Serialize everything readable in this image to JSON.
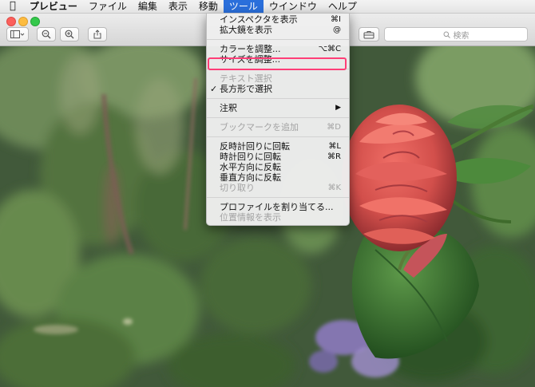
{
  "menubar": {
    "apple_icon": "apple-logo",
    "items": [
      "プレビュー",
      "ファイル",
      "編集",
      "表示",
      "移動",
      "ツール",
      "ウインドウ",
      "ヘルプ"
    ]
  },
  "toolbar": {
    "search_placeholder": "検索",
    "icons": [
      "sidebar-icon",
      "zoom-out-icon",
      "zoom-in-icon",
      "share-icon",
      "markup-toolbox-icon",
      "search-icon"
    ]
  },
  "tools_menu": {
    "inspector": {
      "label": "インスペクタを表示",
      "shortcut": "⌘I"
    },
    "magnifier": {
      "label": "拡大鏡を表示",
      "shortcut": "@"
    },
    "adjust_color": {
      "label": "カラーを調整...",
      "shortcut": "⌥⌘C"
    },
    "adjust_size": {
      "label": "サイズを調整..."
    },
    "text_selection": {
      "label": "テキスト選択"
    },
    "rect_selection": {
      "label": "長方形で選択",
      "checkmark": "✓"
    },
    "annotate": {
      "label": "注釈",
      "arrow": "▶"
    },
    "add_bookmark": {
      "label": "ブックマークを追加",
      "shortcut": "⌘D"
    },
    "rotate_left": {
      "label": "反時計回りに回転",
      "shortcut": "⌘L"
    },
    "rotate_right": {
      "label": "時計回りに回転",
      "shortcut": "⌘R"
    },
    "flip_horizontal": {
      "label": "水平方向に反転"
    },
    "flip_vertical": {
      "label": "垂直方向に反転"
    },
    "crop": {
      "label": "切り取り",
      "shortcut": "⌘K"
    },
    "assign_profile": {
      "label": "プロファイルを割り当てる..."
    },
    "show_location": {
      "label": "位置情報を表示"
    }
  },
  "colors": {
    "menu_active": "#2a6fdb",
    "highlight_box": "#ff3e77",
    "foliage": "#3f5a33",
    "flower": "#e05b55"
  }
}
